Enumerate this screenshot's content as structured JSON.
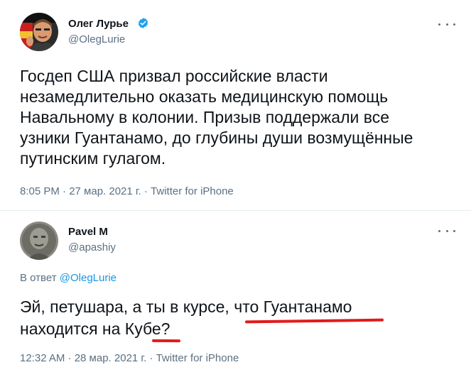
{
  "tweets": [
    {
      "author_name": "Олег Лурье",
      "author_handle": "@OlegLurie",
      "verified": true,
      "more_icon": "more-horizontal-icon",
      "text_lines": [
        "Госдеп США призвал российские власти",
        "незамедлительно оказать медицинскую помощь",
        "Навальному в колонии. Призыв поддержали все",
        "узники  Гуантанамо, до глубины души возмущённые",
        "путинским гулагом."
      ],
      "meta": "8:05 PM · 27 мар. 2021 г. · Twitter for iPhone"
    },
    {
      "author_name": "Pavel M",
      "author_handle": "@apashiy",
      "verified": false,
      "more_icon": "more-horizontal-icon",
      "reply_prefix": "В ответ ",
      "reply_to": "@OlegLurie",
      "text_lines": [
        "Эй, петушара, а ты в курсе, что Гуантанамо",
        "находится на Кубе?"
      ],
      "meta": "12:32 AM · 28 мар. 2021 г. · Twitter for iPhone"
    }
  ],
  "colors": {
    "text": "#0f1419",
    "secondary": "#5b7083",
    "link": "#1b95e0",
    "verified_badge": "#1da1f2",
    "annotation_underline": "#e11b1b",
    "divider": "#e6ecf0"
  }
}
